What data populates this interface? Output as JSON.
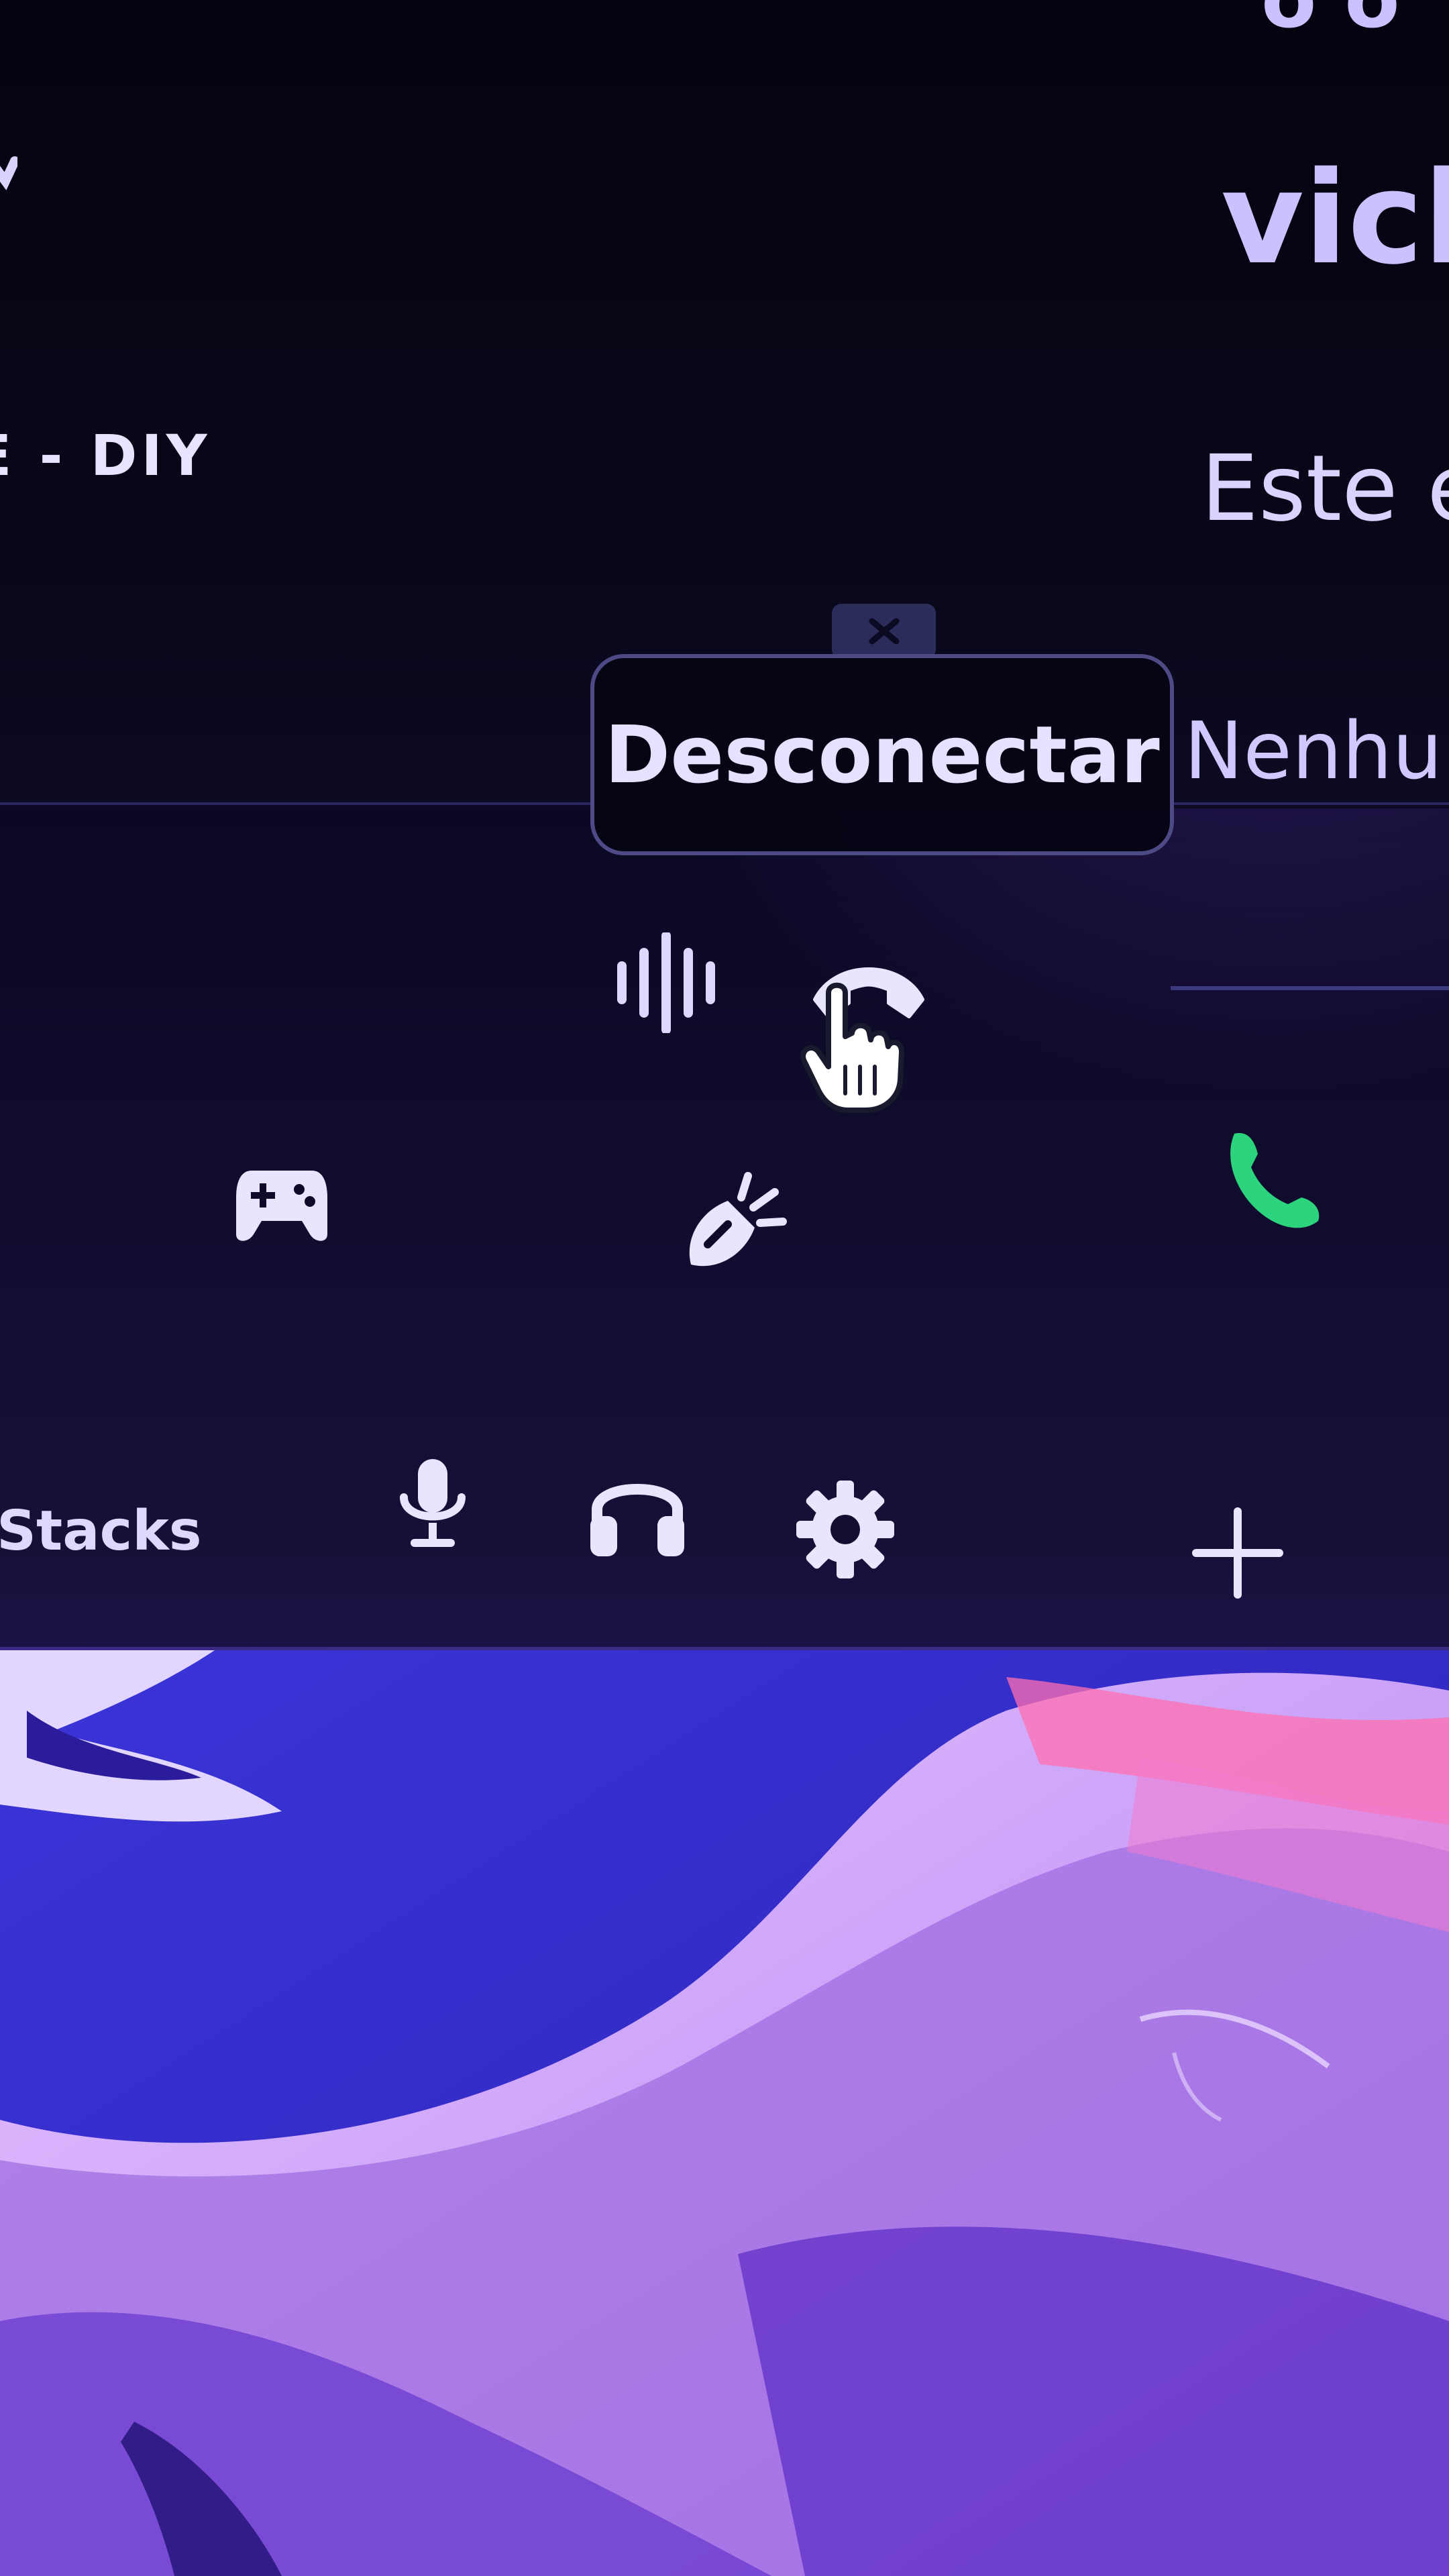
{
  "server": {
    "name": "E - DIY"
  },
  "profile": {
    "name_partial_top": "o o",
    "username": "vick",
    "description": "Este é",
    "activity": "Nenhum"
  },
  "voice": {
    "tooltip_label": "Desconectar",
    "icons": [
      "soundboard-wave-icon",
      "disconnect-phone-icon",
      "game-controller-icon",
      "activity-rocket-icon",
      "call-icon"
    ]
  },
  "userbar": {
    "label": "Stacks",
    "icons": [
      "microphone-icon",
      "headphones-icon",
      "gear-icon"
    ]
  },
  "sidebar": {
    "add_icon": "plus-icon"
  },
  "colors": {
    "background": "#07061a",
    "accent_green": "#2bd47d",
    "text": "#e5e2ff"
  }
}
